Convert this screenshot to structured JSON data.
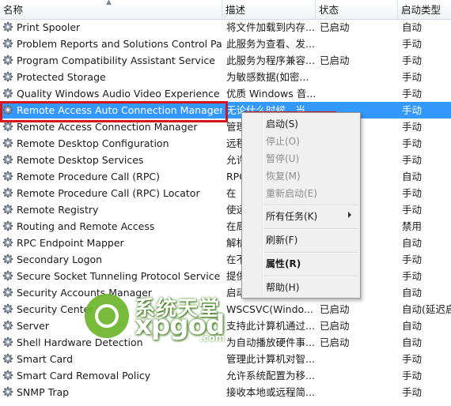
{
  "columns": {
    "name": "名称",
    "desc": "描述",
    "status": "状态",
    "type": "启动类型"
  },
  "rows": [
    {
      "name": "Print Spooler",
      "desc": "将文件加载到内存...",
      "status": "已启动",
      "type": "自动"
    },
    {
      "name": "Problem Reports and Solutions Control Pa...",
      "desc": "此服务为查看、发...",
      "status": "",
      "type": "手动"
    },
    {
      "name": "Program Compatibility Assistant Service",
      "desc": "此服务为程序兼容...",
      "status": "已启动",
      "type": "手动"
    },
    {
      "name": "Protected Storage",
      "desc": "为敏感数据(如密...",
      "status": "",
      "type": "手动"
    },
    {
      "name": "Quality Windows Audio Video Experience",
      "desc": "优质 Windows 音...",
      "status": "",
      "type": "手动"
    },
    {
      "name": "Remote Access Auto Connection Manager",
      "desc": "无论什么时候，当...",
      "status": "",
      "type": "手动"
    },
    {
      "name": "Remote Access Connection Manager",
      "desc": "管理",
      "status": "",
      "type": "手动"
    },
    {
      "name": "Remote Desktop Configuration",
      "desc": "远程",
      "status": "",
      "type": "手动"
    },
    {
      "name": "Remote Desktop Services",
      "desc": "允许",
      "status": "",
      "type": "手动"
    },
    {
      "name": "Remote Procedure Call (RPC)",
      "desc": "RPC",
      "status": "",
      "type": "自动"
    },
    {
      "name": "Remote Procedure Call (RPC) Locator",
      "desc": "在",
      "status": "",
      "type": "手动"
    },
    {
      "name": "Remote Registry",
      "desc": "使远",
      "status": "",
      "type": "手动"
    },
    {
      "name": "Routing and Remote Access",
      "desc": "在局",
      "status": "",
      "type": "禁用"
    },
    {
      "name": "RPC Endpoint Mapper",
      "desc": "解析",
      "status": "",
      "type": "自动"
    },
    {
      "name": "Secondary Logon",
      "desc": "在不",
      "status": "",
      "type": "手动"
    },
    {
      "name": "Secure Socket Tunneling Protocol Service",
      "desc": "提供",
      "status": "",
      "type": "手动"
    },
    {
      "name": "Security Accounts Manager",
      "desc": "启动",
      "status": "",
      "type": "自动"
    },
    {
      "name": "Security Center",
      "desc": "WSCSVC(Windo...",
      "status": "已启动",
      "type": "自动(延迟启"
    },
    {
      "name": "Server",
      "desc": "支持此计算机通过...",
      "status": "已启动",
      "type": "自动"
    },
    {
      "name": "Shell Hardware Detection",
      "desc": "为自动播放硬件事...",
      "status": "已启动",
      "type": "自动"
    },
    {
      "name": "Smart Card",
      "desc": "管理此计算机对智...",
      "status": "",
      "type": "手动"
    },
    {
      "name": "Smart Card Removal Policy",
      "desc": "允许系统配置为移...",
      "status": "",
      "type": "手动"
    },
    {
      "name": "SNMP Trap",
      "desc": "接收本地或远程简...",
      "status": "",
      "type": "手动"
    }
  ],
  "selected_row": "Remote Access Auto Connection Manager",
  "context_menu": {
    "start": "启动(S)",
    "stop": "停止(O)",
    "pause": "暂停(U)",
    "resume": "恢复(M)",
    "restart": "重新启动(E)",
    "all_tasks": "所有任务(K)",
    "refresh": "刷新(F)",
    "properties": "属性(R)",
    "help": "帮助(H)"
  },
  "watermark": {
    "cn": "系统天堂",
    "en": "xpgod",
    "com": ".com"
  },
  "colors": {
    "selection": "#3399ff",
    "highlight_box": "#d4161c",
    "watermark_green": "#6db52a"
  },
  "icons": {
    "service": "gear-icon",
    "submenu": "submenu-arrow-icon"
  }
}
